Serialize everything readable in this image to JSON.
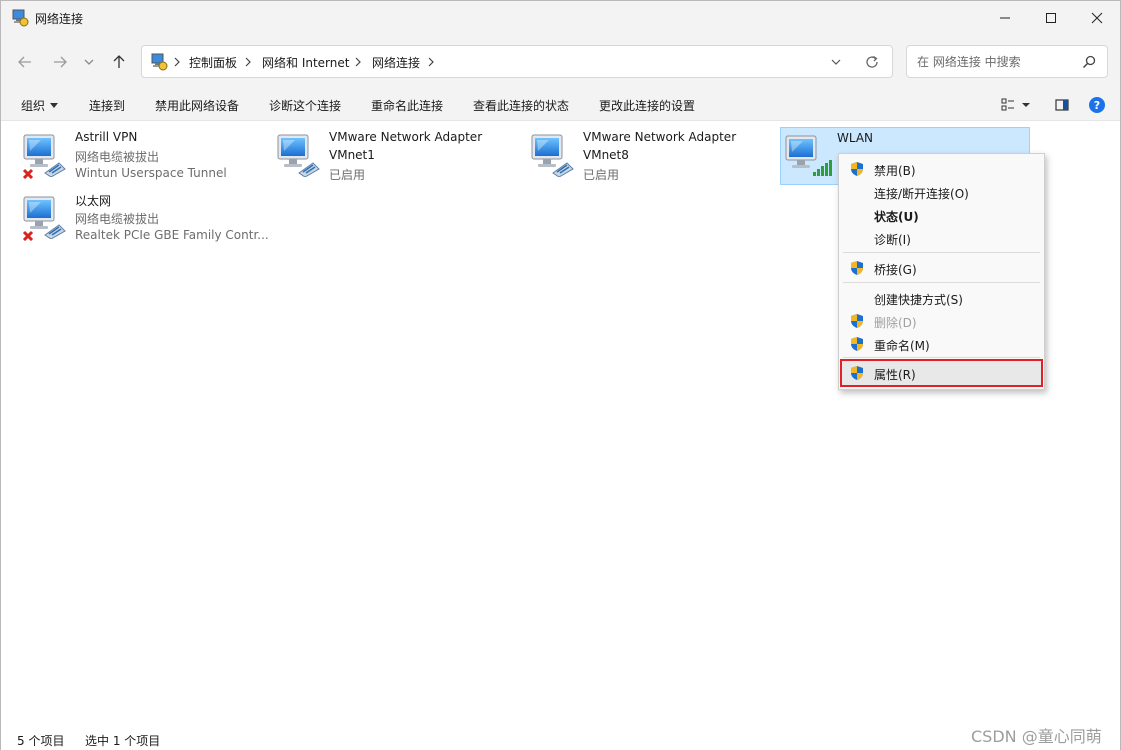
{
  "window": {
    "title": "网络连接"
  },
  "address": {
    "crumbs": [
      "控制面板",
      "网络和 Internet",
      "网络连接"
    ]
  },
  "search": {
    "placeholder": "在 网络连接 中搜索"
  },
  "commands": {
    "organize": "组织",
    "connect_to": "连接到",
    "disable_device": "禁用此网络设备",
    "diagnose": "诊断这个连接",
    "rename": "重命名此连接",
    "view_status": "查看此连接的状态",
    "change_settings": "更改此连接的设置"
  },
  "connections": [
    {
      "name": "Astrill VPN",
      "status": "网络电缆被拔出",
      "device": "Wintun Userspace Tunnel",
      "state": "unplugged"
    },
    {
      "name": "VMware Network Adapter",
      "name2": "VMnet1",
      "status": "已启用",
      "state": "enabled"
    },
    {
      "name": "VMware Network Adapter",
      "name2": "VMnet8",
      "status": "已启用",
      "state": "enabled"
    },
    {
      "name": "WLAN",
      "state": "wifi",
      "selected": true
    },
    {
      "name": "以太网",
      "status": "网络电缆被拔出",
      "device": "Realtek PCIe GBE Family Contr...",
      "state": "unplugged"
    }
  ],
  "context_menu": {
    "items": [
      {
        "label": "禁用(B)",
        "shield": true
      },
      {
        "label": "连接/断开连接(O)"
      },
      {
        "label": "状态(U)",
        "bold": true
      },
      {
        "label": "诊断(I)"
      },
      {
        "label": "桥接(G)",
        "shield": true
      },
      {
        "label": "创建快捷方式(S)"
      },
      {
        "label": "删除(D)",
        "shield": true,
        "disabled": true
      },
      {
        "label": "重命名(M)",
        "shield": true
      },
      {
        "label": "属性(R)",
        "shield": true,
        "highlighted": true
      }
    ]
  },
  "statusbar": {
    "count": "5 个项目",
    "selected": "选中 1 个项目"
  },
  "watermark": "CSDN @童心同萌",
  "colors": {
    "selection_bg": "#cce8ff",
    "selection_border": "#99d1ff",
    "highlight_box": "#e02127",
    "help": "#1a73e8"
  }
}
